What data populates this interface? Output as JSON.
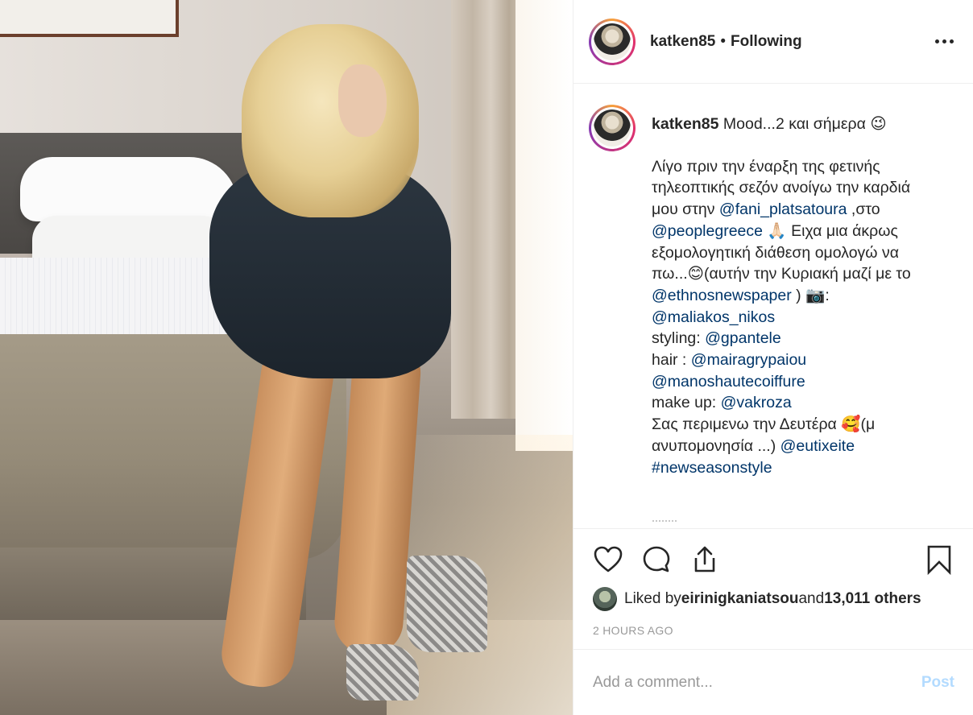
{
  "header": {
    "username": "katken85",
    "separator": "•",
    "follow_status": "Following",
    "more_icon": "ellipsis-icon"
  },
  "caption": {
    "username": "katken85",
    "title": "Mood...2 και σήμερα 😉",
    "line1": "Λίγο πριν την έναρξη της φετινής τηλεοπτικής σεζόν ανοίγω την καρδιά μου στην ",
    "mention1": "@fani_platsatoura",
    "line2": " ,στο ",
    "mention2": "@peoplegreece",
    "line3": " 🙏🏻 Ειχα μια άκρως εξομολογητική διάθεση ομολογώ να πω...😊(αυτήν την Κυριακή μαζί με το ",
    "mention3": "@ethnosnewspaper",
    "line4": " ) 📷: ",
    "mention4": "@maliakos_nikos",
    "styling_label": "styling: ",
    "mention5": "@gpantele",
    "hair_label": "hair : ",
    "mention6": "@mairagrypaiou",
    "mention7": "@manoshautecoiffure",
    "makeup_label": "make up: ",
    "mention8": "@vakroza",
    "line5": "Σας περιμενω την Δευτέρα 🥰(μ ανυπομονησία ...) ",
    "mention9": "@eutixeite",
    "hashtag": "#newseasonstyle"
  },
  "actions": {
    "like_icon": "heart-icon",
    "comment_icon": "comment-icon",
    "share_icon": "share-icon",
    "save_icon": "bookmark-icon"
  },
  "likes": {
    "prefix": "Liked by ",
    "liker": "eirinigkaniatsou",
    "middle": " and ",
    "others": "13,011 others"
  },
  "timestamp": "2 HOURS AGO",
  "comment_box": {
    "placeholder": "Add a comment...",
    "post_label": "Post"
  }
}
